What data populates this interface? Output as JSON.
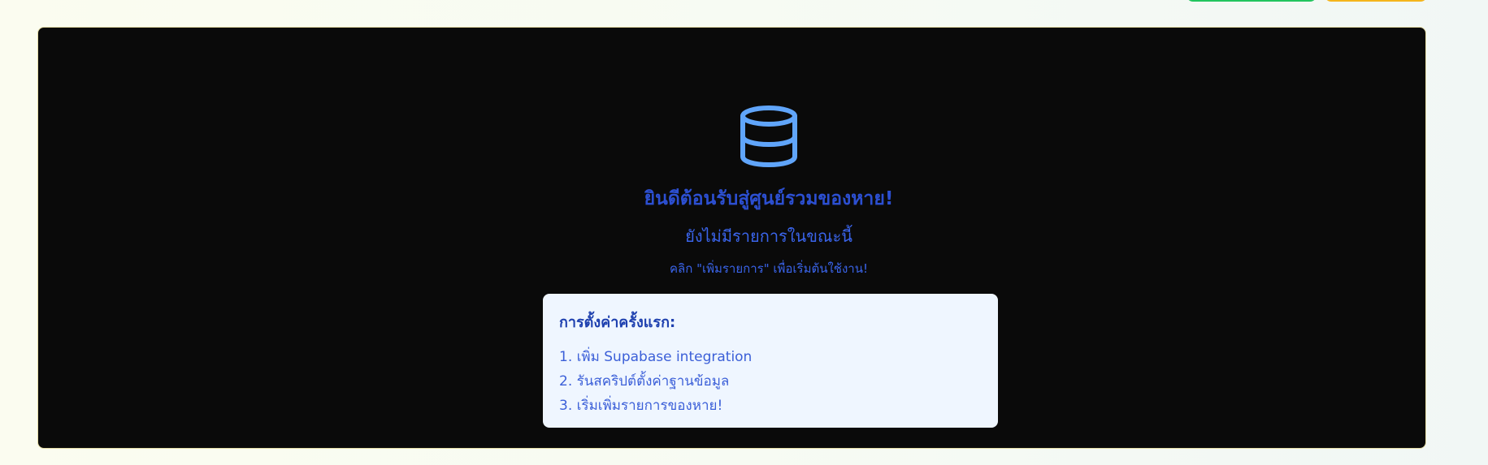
{
  "empty_state": {
    "icon": "database-icon",
    "title": "ยินดีต้อนรับสู่ศูนย์รวมของหาย!",
    "subtitle": "ยังไม่มีรายการในขณะนี้",
    "hint": "คลิก \"เพิ่มรายการ\" เพื่อเริ่มต้นใช้งาน!"
  },
  "setup": {
    "heading": "การตั้งค่าครั้งแรก:",
    "steps": [
      "1. เพิ่ม Supabase integration",
      "2. รันสคริปต์ตั้งค่าฐานข้อมูล",
      "3. เริ่มเพิ่มรายการของหาย!"
    ]
  },
  "colors": {
    "card_background": "#0a0a0a",
    "accent_blue": "#2c4fd1",
    "setup_background": "#eff6ff",
    "header_button_green": "#22c55e",
    "header_button_yellow": "#f5b51c"
  }
}
